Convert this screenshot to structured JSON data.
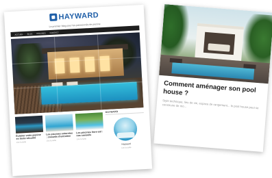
{
  "article": {
    "title": "Comment aménager son pool house ?",
    "excerpt": "Style technique, lieu de vie, espace de rangement... le pool house peut se construire de mo..."
  },
  "site": {
    "logo": "HAYWARD",
    "tagline": "Le premier blog pour les passionnés de piscine",
    "nav": [
      "ACCUEIL",
      "BLOG",
      "PISCINES",
      "CONTACT"
    ],
    "thumbs": [
      {
        "title": "Éclairer votre piscine en toute sécurité",
        "meta": "Lire la suite"
      },
      {
        "title": "Les piscines enterrées : conseils d'entretien",
        "meta": "Lire la suite"
      },
      {
        "title": "Les piscines hors-sol : nos conseils",
        "meta": "Lire la suite"
      }
    ],
    "sidebar": {
      "heading": "HAYWARD",
      "name": "Hayward",
      "sub": "Lire la suite"
    }
  }
}
